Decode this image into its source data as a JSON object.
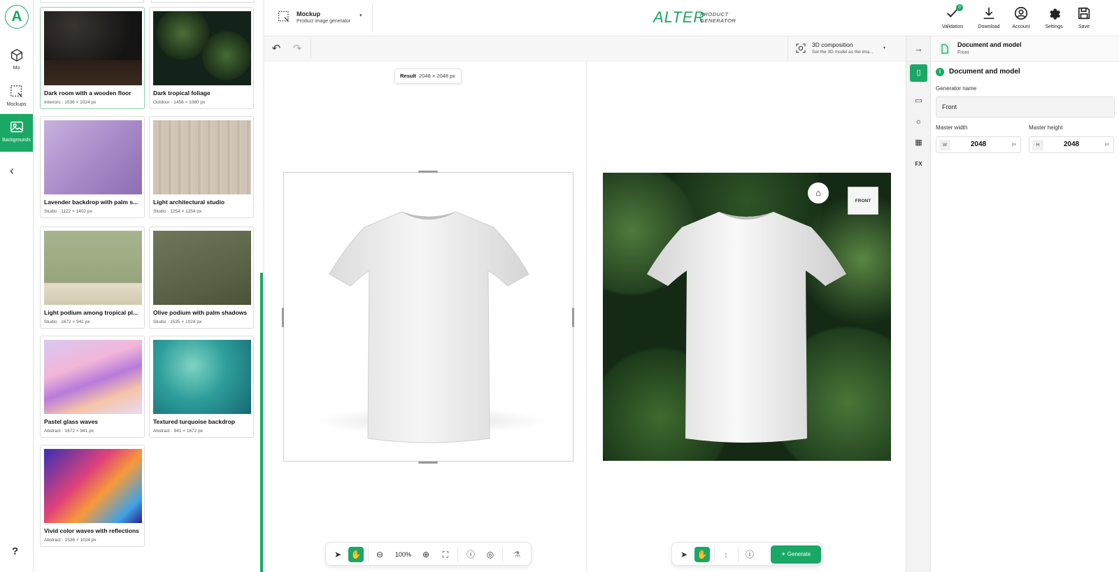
{
  "rail": {
    "logo": "A",
    "items": [
      {
        "label": "Mo",
        "icon": "cube-icon"
      },
      {
        "label": "Mockups",
        "icon": "mockup-icon"
      },
      {
        "label": "Backgrounds",
        "icon": "image-icon"
      }
    ],
    "help": "?"
  },
  "gallery": [
    {
      "title": "Dark room with a wooden floor",
      "meta": "Interiors · 1536 × 1024 px"
    },
    {
      "title": "Dark tropical foliage",
      "meta": "Outdoor · 1456 × 1080 px"
    },
    {
      "title": "Lavender backdrop with palm s...",
      "meta": "Studio · 1122 × 1402 px"
    },
    {
      "title": "Light architectural studio",
      "meta": "Studio · 1254 × 1254 px"
    },
    {
      "title": "Light podium among tropical pl...",
      "meta": "Studio · 1672 × 941 px"
    },
    {
      "title": "Olive podium with palm shadows",
      "meta": "Studio · 1535 × 1024 px"
    },
    {
      "title": "Pastel glass waves",
      "meta": "Abstract · 1672 × 941 px"
    },
    {
      "title": "Textured turquoise backdrop",
      "meta": "Abstract · 941 × 1672 px"
    },
    {
      "title": "Vivid color waves with reflections",
      "meta": "Abstract · 1536 × 1024 px"
    }
  ],
  "topbar": {
    "mode_title": "Mockup",
    "mode_subtitle": "Product image generator",
    "brand": "ALTER",
    "brand_sub1": "PRODUCT",
    "brand_sub2": "GENERATOR",
    "validation_label": "Validation",
    "validation_count": "0",
    "download_label": "Download",
    "account_label": "Account",
    "settings_label": "Settings",
    "save_label": "Save"
  },
  "composition": {
    "title": "3D composition",
    "subtitle": "Set the 3D model as the ima..."
  },
  "canvas": {
    "result_label": "Result",
    "result_size": "2048 × 2048 px",
    "front_button": "FRONT"
  },
  "bottom_left": {
    "zoom": "100%"
  },
  "bottom_right": {
    "generate": "Generate"
  },
  "panel": {
    "header_title": "Document and model",
    "header_subtitle": "Front",
    "section_title": "Document and model",
    "generator_name_label": "Generator name",
    "generator_name_value": "Front",
    "width_label": "Master width",
    "width_key": "W",
    "width_value": "2048",
    "height_label": "Master height",
    "height_key": "H",
    "height_value": "2048",
    "unit": "px"
  },
  "colors": {
    "accent": "#1aa866"
  }
}
